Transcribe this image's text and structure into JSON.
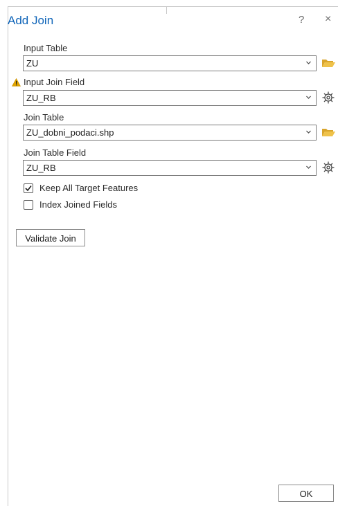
{
  "dialog": {
    "title": "Add Join",
    "help": "?",
    "close": "×"
  },
  "fields": {
    "input_table": {
      "label": "Input Table",
      "value": "ZU"
    },
    "input_join_field": {
      "label": "Input Join Field",
      "value": "ZU_RB"
    },
    "join_table": {
      "label": "Join Table",
      "value": "ZU_dobni_podaci.shp"
    },
    "join_table_field": {
      "label": "Join Table Field",
      "value": "ZU_RB"
    }
  },
  "options": {
    "keep_all": {
      "label": "Keep All Target Features",
      "checked": true
    },
    "index_joined": {
      "label": "Index Joined Fields",
      "checked": false
    }
  },
  "buttons": {
    "validate": "Validate Join",
    "ok": "OK"
  },
  "icons": {
    "warning": "warning-icon",
    "folder": "folder-open-icon",
    "gear": "gear-icon",
    "chevron": "chevron-down-icon",
    "check": "checkmark-icon"
  },
  "colors": {
    "title": "#0d63b8",
    "folder": "#e8b73a",
    "warning": "#e0a400"
  }
}
